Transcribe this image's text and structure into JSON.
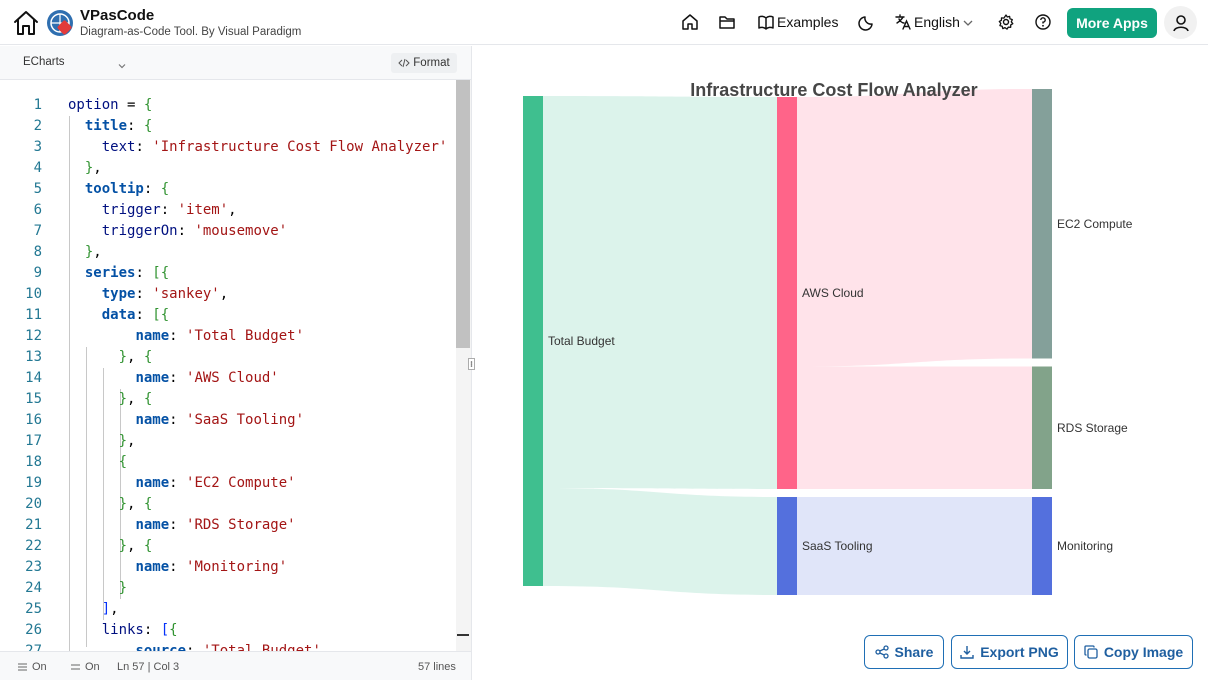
{
  "header": {
    "app_title": "VPasCode",
    "app_subtitle": "Diagram-as-Code Tool. By Visual Paradigm",
    "examples_label": "Examples",
    "language_label": "English",
    "more_apps_label": "More Apps",
    "accent_color": "#10a37f"
  },
  "editor": {
    "language_select": "ECharts",
    "format_label": "Format",
    "line_numbers": [
      "1",
      "2",
      "3",
      "4",
      "5",
      "6",
      "7",
      "8",
      "9",
      "10",
      "11",
      "12",
      "13",
      "14",
      "15",
      "16",
      "17",
      "18",
      "19",
      "20",
      "21",
      "22",
      "23",
      "24",
      "25",
      "26",
      "27"
    ],
    "status": {
      "wrap_label": "On",
      "minimap_label": "On",
      "cursor": "Ln 57 | Col 3",
      "line_count": "57 lines"
    }
  },
  "chart_data": {
    "type": "sankey",
    "title": "Infrastructure Cost Flow Analyzer",
    "nodes": [
      {
        "name": "Total Budget",
        "label": "Total Budget",
        "color": "#3fbf8f",
        "depth": 0
      },
      {
        "name": "AWS Cloud",
        "label": "AWS Cloud",
        "color": "#ff6489",
        "depth": 1
      },
      {
        "name": "SaaS Tooling",
        "label": "SaaS Tooling",
        "color": "#5470dd",
        "depth": 1
      },
      {
        "name": "EC2 Compute",
        "label": "EC2 Compute",
        "color": "#84a09a",
        "depth": 2
      },
      {
        "name": "RDS Storage",
        "label": "RDS Storage",
        "color": "#82a38a",
        "depth": 2
      },
      {
        "name": "Monitoring",
        "label": "Monitoring",
        "color": "#5470dd",
        "depth": 2
      }
    ],
    "links": [
      {
        "source": "Total Budget",
        "target": "AWS Cloud",
        "value": 80
      },
      {
        "source": "Total Budget",
        "target": "SaaS Tooling",
        "value": 20
      },
      {
        "source": "AWS Cloud",
        "target": "EC2 Compute",
        "value": 55
      },
      {
        "source": "AWS Cloud",
        "target": "RDS Storage",
        "value": 25
      },
      {
        "source": "SaaS Tooling",
        "target": "Monitoring",
        "value": 20
      }
    ]
  },
  "actions": {
    "share_label": "Share",
    "export_label": "Export PNG",
    "copy_label": "Copy Image"
  }
}
